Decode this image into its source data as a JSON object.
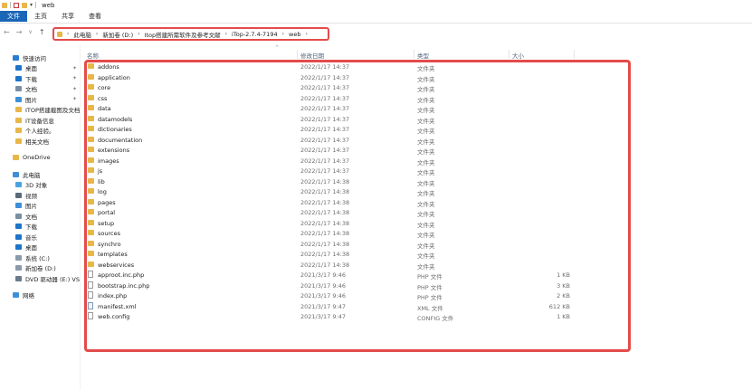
{
  "window": {
    "title": "web"
  },
  "ribbon": {
    "tabs": [
      "文件",
      "主页",
      "共享",
      "查看"
    ]
  },
  "nav": {
    "back": "←",
    "forward": "→",
    "dropdown": "∨",
    "up": "↑"
  },
  "address": {
    "crumbs": [
      "此电脑",
      "新加卷 (D:)",
      "Itop搭建所需软件及参考文献",
      "iTop-2.7.4-7194",
      "web"
    ]
  },
  "sidebar": {
    "quick_access": [
      {
        "label": "快速访问",
        "icon": "star-icon",
        "color": "#2b7cd3",
        "pinned": false
      },
      {
        "label": "桌面",
        "icon": "desktop-icon",
        "color": "#1e74c9",
        "pinned": true
      },
      {
        "label": "下载",
        "icon": "download-icon",
        "color": "#1e74c9",
        "pinned": true
      },
      {
        "label": "文档",
        "icon": "document-icon",
        "color": "#7a8ea3",
        "pinned": true
      },
      {
        "label": "图片",
        "icon": "picture-icon",
        "color": "#3f8fd8",
        "pinned": true
      },
      {
        "label": "ITOP搭建截图及文档",
        "icon": "folder-icon",
        "color": "#e8b74a",
        "pinned": false
      },
      {
        "label": "IT设备信息",
        "icon": "folder-icon",
        "color": "#e8b74a",
        "pinned": false
      },
      {
        "label": "个人经验。",
        "icon": "folder-icon",
        "color": "#e8b74a",
        "pinned": false
      },
      {
        "label": "相关文档",
        "icon": "folder-icon",
        "color": "#e8b74a",
        "pinned": false
      }
    ],
    "onedrive": {
      "label": "OneDrive",
      "icon": "onedrive-icon",
      "color": "#e8b74a"
    },
    "this_pc": [
      {
        "label": "此电脑",
        "icon": "computer-icon",
        "color": "#3f8fd8"
      },
      {
        "label": "3D 对象",
        "icon": "cube-icon",
        "color": "#4aa3e0"
      },
      {
        "label": "视频",
        "icon": "video-icon",
        "color": "#5a6a7a"
      },
      {
        "label": "图片",
        "icon": "picture-icon",
        "color": "#3f8fd8"
      },
      {
        "label": "文档",
        "icon": "document-icon",
        "color": "#7a8ea3"
      },
      {
        "label": "下载",
        "icon": "download-icon",
        "color": "#1e74c9"
      },
      {
        "label": "音乐",
        "icon": "music-icon",
        "color": "#1e74c9"
      },
      {
        "label": "桌面",
        "icon": "desktop-icon",
        "color": "#1e74c9"
      },
      {
        "label": "系统 (C:)",
        "icon": "drive-icon",
        "color": "#8a9aaa"
      },
      {
        "label": "新加卷 (D:)",
        "icon": "drive-icon",
        "color": "#8a9aaa"
      },
      {
        "label": "DVD 驱动器 (E:) VS",
        "icon": "dvd-icon",
        "color": "#6a7a8a"
      }
    ],
    "network": {
      "label": "网络",
      "icon": "network-icon",
      "color": "#3f8fd8"
    },
    "pin_glyph": "✦"
  },
  "columns": {
    "name": "名称",
    "modified": "修改日期",
    "type": "类型",
    "size": "大小",
    "sort_glyph": "^"
  },
  "files": [
    {
      "name": "addons",
      "modified": "2022/1/17 14:37",
      "type": "文件夹",
      "size": "",
      "icon": "folder-icon"
    },
    {
      "name": "application",
      "modified": "2022/1/17 14:37",
      "type": "文件夹",
      "size": "",
      "icon": "folder-icon"
    },
    {
      "name": "core",
      "modified": "2022/1/17 14:37",
      "type": "文件夹",
      "size": "",
      "icon": "folder-icon"
    },
    {
      "name": "css",
      "modified": "2022/1/17 14:37",
      "type": "文件夹",
      "size": "",
      "icon": "folder-icon"
    },
    {
      "name": "data",
      "modified": "2022/1/17 14:37",
      "type": "文件夹",
      "size": "",
      "icon": "folder-icon"
    },
    {
      "name": "datamodels",
      "modified": "2022/1/17 14:37",
      "type": "文件夹",
      "size": "",
      "icon": "folder-icon"
    },
    {
      "name": "dictionaries",
      "modified": "2022/1/17 14:37",
      "type": "文件夹",
      "size": "",
      "icon": "folder-icon"
    },
    {
      "name": "documentation",
      "modified": "2022/1/17 14:37",
      "type": "文件夹",
      "size": "",
      "icon": "folder-icon"
    },
    {
      "name": "extensions",
      "modified": "2022/1/17 14:37",
      "type": "文件夹",
      "size": "",
      "icon": "folder-icon"
    },
    {
      "name": "images",
      "modified": "2022/1/17 14:37",
      "type": "文件夹",
      "size": "",
      "icon": "folder-icon"
    },
    {
      "name": "js",
      "modified": "2022/1/17 14:37",
      "type": "文件夹",
      "size": "",
      "icon": "folder-icon"
    },
    {
      "name": "lib",
      "modified": "2022/1/17 14:38",
      "type": "文件夹",
      "size": "",
      "icon": "folder-icon"
    },
    {
      "name": "log",
      "modified": "2022/1/17 14:38",
      "type": "文件夹",
      "size": "",
      "icon": "folder-icon"
    },
    {
      "name": "pages",
      "modified": "2022/1/17 14:38",
      "type": "文件夹",
      "size": "",
      "icon": "folder-icon"
    },
    {
      "name": "portal",
      "modified": "2022/1/17 14:38",
      "type": "文件夹",
      "size": "",
      "icon": "folder-icon"
    },
    {
      "name": "setup",
      "modified": "2022/1/17 14:38",
      "type": "文件夹",
      "size": "",
      "icon": "folder-icon"
    },
    {
      "name": "sources",
      "modified": "2022/1/17 14:38",
      "type": "文件夹",
      "size": "",
      "icon": "folder-icon"
    },
    {
      "name": "synchro",
      "modified": "2022/1/17 14:38",
      "type": "文件夹",
      "size": "",
      "icon": "folder-icon"
    },
    {
      "name": "templates",
      "modified": "2022/1/17 14:38",
      "type": "文件夹",
      "size": "",
      "icon": "folder-icon"
    },
    {
      "name": "webservices",
      "modified": "2022/1/17 14:38",
      "type": "文件夹",
      "size": "",
      "icon": "folder-icon"
    },
    {
      "name": "approot.inc.php",
      "modified": "2021/3/17 9:46",
      "type": "PHP 文件",
      "size": "1 KB",
      "icon": "php-file-icon"
    },
    {
      "name": "bootstrap.inc.php",
      "modified": "2021/3/17 9:46",
      "type": "PHP 文件",
      "size": "3 KB",
      "icon": "php-file-icon"
    },
    {
      "name": "index.php",
      "modified": "2021/3/17 9:46",
      "type": "PHP 文件",
      "size": "2 KB",
      "icon": "php-file-icon"
    },
    {
      "name": "manifest.xml",
      "modified": "2021/3/17 9:47",
      "type": "XML 文件",
      "size": "612 KB",
      "icon": "xml-file-icon"
    },
    {
      "name": "web.config",
      "modified": "2021/3/17 9:47",
      "type": "CONFIG 文件",
      "size": "1 KB",
      "icon": "config-file-icon"
    }
  ],
  "colors": {
    "file_tab": "#1a66b7",
    "highlight": "#e44b4b",
    "folder": "#e8b74a"
  }
}
